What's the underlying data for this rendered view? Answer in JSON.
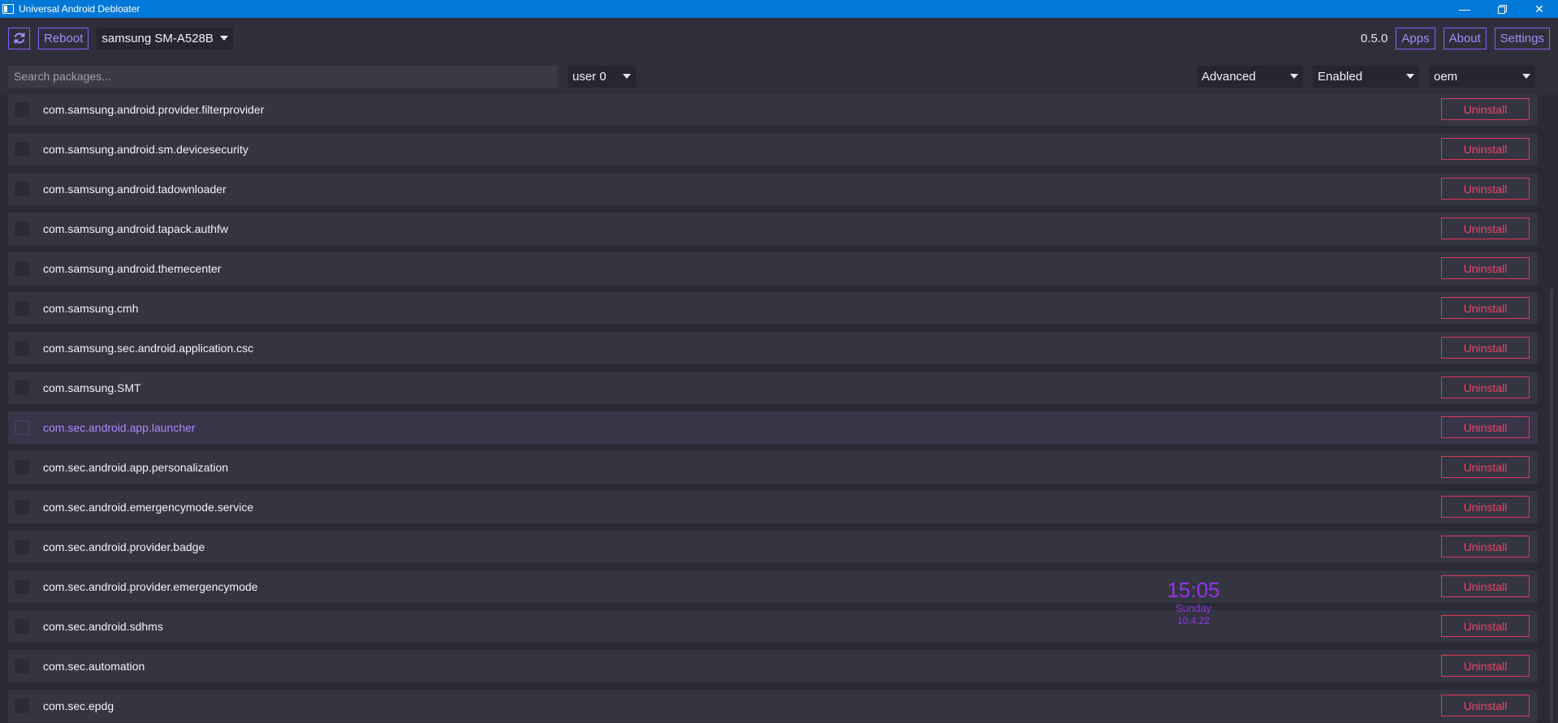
{
  "window": {
    "title": "Universal Android Debloater",
    "minimize": "—",
    "close": "✕"
  },
  "toolbar": {
    "refresh_icon": "refresh-icon",
    "reboot_label": "Reboot",
    "device": "samsung SM-A528B",
    "version": "0.5.0",
    "apps_label": "Apps",
    "about_label": "About",
    "settings_label": "Settings"
  },
  "filters": {
    "search_placeholder": "Search packages...",
    "user": "user 0",
    "mode": "Advanced",
    "state": "Enabled",
    "list": "oem"
  },
  "packages": {
    "uninstall_label": "Uninstall",
    "items": [
      "com.samsung.android.provider.filterprovider",
      "com.samsung.android.sm.devicesecurity",
      "com.samsung.android.tadownloader",
      "com.samsung.android.tapack.authfw",
      "com.samsung.android.themecenter",
      "com.samsung.cmh",
      "com.samsung.sec.android.application.csc",
      "com.samsung.SMT",
      "com.sec.android.app.launcher",
      "com.sec.android.app.personalization",
      "com.sec.android.emergencymode.service",
      "com.sec.android.provider.badge",
      "com.sec.android.provider.emergencymode",
      "com.sec.android.sdhms",
      "com.sec.automation",
      "com.sec.epdg"
    ],
    "highlighted_index": 8
  },
  "clock": {
    "time": "15:05",
    "day": "Sunday",
    "date": "10.4.22"
  },
  "colors": {
    "accent": "#8b5cf6",
    "danger": "#e0365a",
    "titlebar": "#0078d7"
  }
}
